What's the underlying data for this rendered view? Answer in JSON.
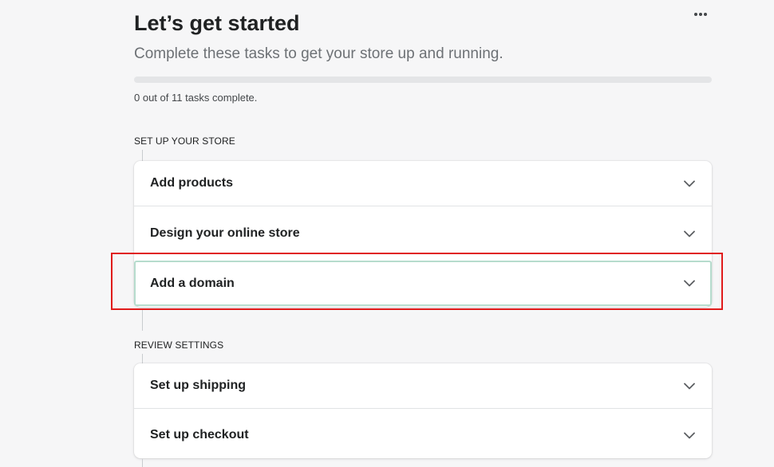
{
  "header": {
    "title": "Let’s get started",
    "subtitle": "Complete these tasks to get your store up and running.",
    "more_icon": "more-horizontal-icon"
  },
  "progress": {
    "completed": 0,
    "total": 11,
    "fraction": 0,
    "text": "0 out of 11 tasks complete.",
    "bar_color": "#008060"
  },
  "sections": [
    {
      "label": "SET UP YOUR STORE",
      "tasks": [
        {
          "label": "Add products",
          "icon": "chevron-down-icon"
        },
        {
          "label": "Design your online store",
          "icon": "chevron-down-icon"
        },
        {
          "label": "Add a domain",
          "icon": "chevron-down-icon",
          "focused": true
        }
      ]
    },
    {
      "label": "REVIEW SETTINGS",
      "tasks": [
        {
          "label": "Set up shipping",
          "icon": "chevron-down-icon"
        },
        {
          "label": "Set up checkout",
          "icon": "chevron-down-icon"
        }
      ]
    }
  ],
  "colors": {
    "background": "#f6f6f7",
    "card": "#ffffff",
    "highlight": "#e01b1b",
    "focus_ring": "#b6dccd"
  }
}
